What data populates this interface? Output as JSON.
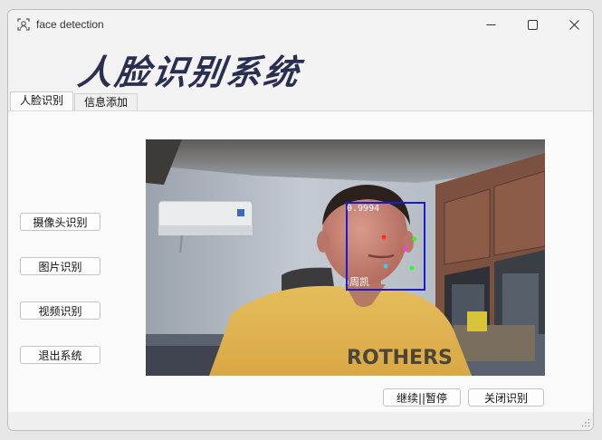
{
  "window": {
    "title": "face detection"
  },
  "banner": {
    "title": "人脸识别系统"
  },
  "tabs": [
    {
      "label": "人脸识别",
      "active": true
    },
    {
      "label": "信息添加",
      "active": false
    }
  ],
  "sidebar": {
    "buttons": [
      {
        "label": "摄像头识别"
      },
      {
        "label": "图片识别"
      },
      {
        "label": "视频识别"
      },
      {
        "label": "退出系统"
      }
    ]
  },
  "camera": {
    "detection": {
      "confidence": "0.9994",
      "name": "周凯",
      "box_color": "#1a1ad0"
    },
    "shirt_text": "ROTHERS"
  },
  "actions": {
    "pause_label": "继续||暂停",
    "close_label": "关闭识别"
  },
  "colors": {
    "banner_text": "#2a2f52",
    "box": "#1a1ad0"
  }
}
